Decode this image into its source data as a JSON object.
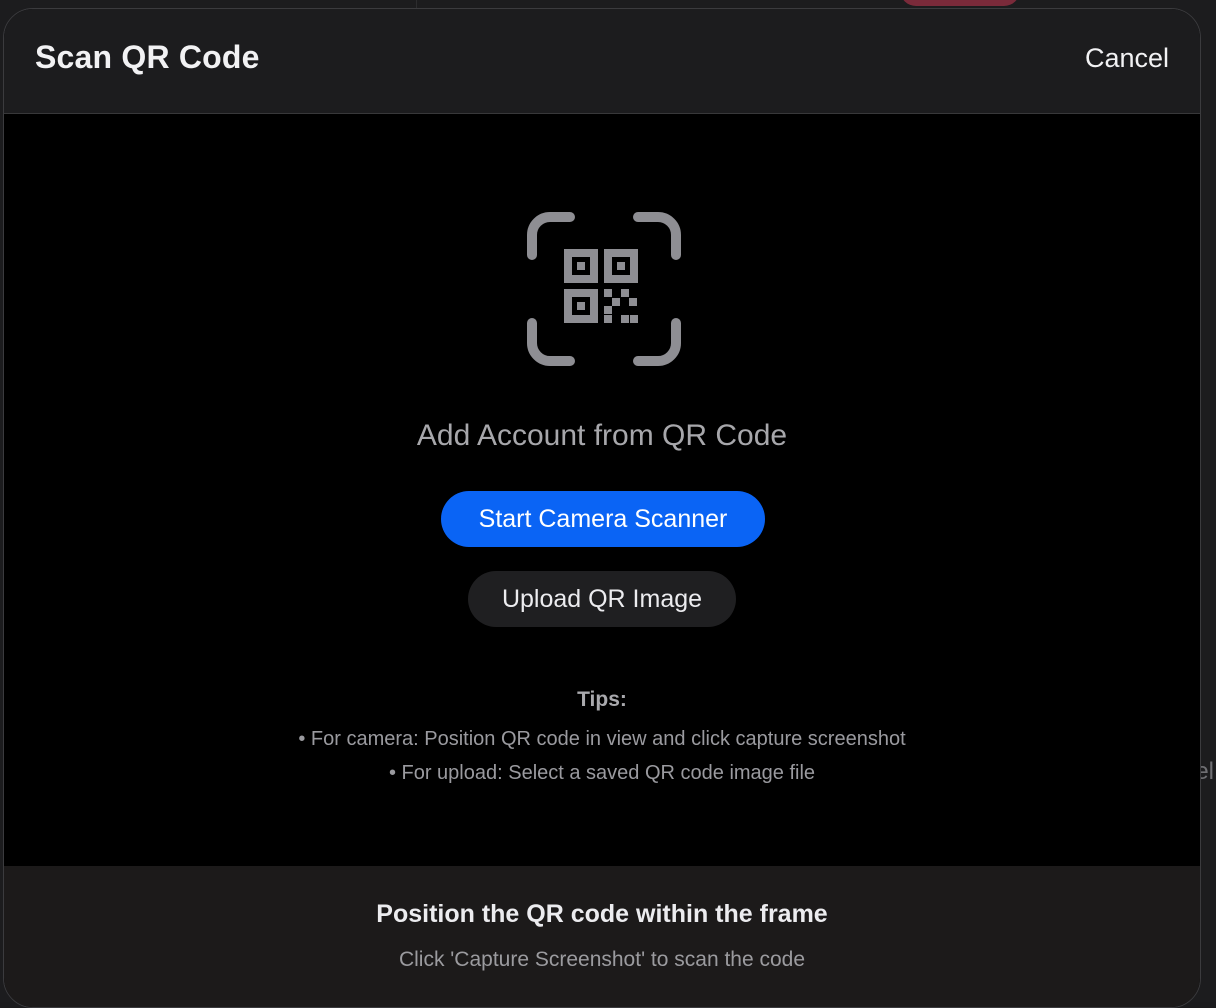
{
  "header": {
    "title": "Scan QR Code",
    "cancel_label": "Cancel"
  },
  "main": {
    "icon": "qr-scan-icon",
    "headline": "Add Account from QR Code",
    "start_camera_label": "Start Camera Scanner",
    "upload_label": "Upload QR Image",
    "tips": {
      "title": "Tips:",
      "items": [
        "• For camera: Position QR code in view and click capture screenshot",
        "• For upload: Select a saved QR code image file"
      ]
    }
  },
  "footer": {
    "title": "Position the QR code within the frame",
    "subtitle": "Click 'Capture Screenshot' to scan the code"
  },
  "background": {
    "fragment_text": "el"
  },
  "colors": {
    "accent": "#0a64f5",
    "sheet_background": "#000000",
    "header_background": "#1c1c1e",
    "footer_background": "#1c1a1a",
    "icon_gray": "#8e8e93"
  }
}
